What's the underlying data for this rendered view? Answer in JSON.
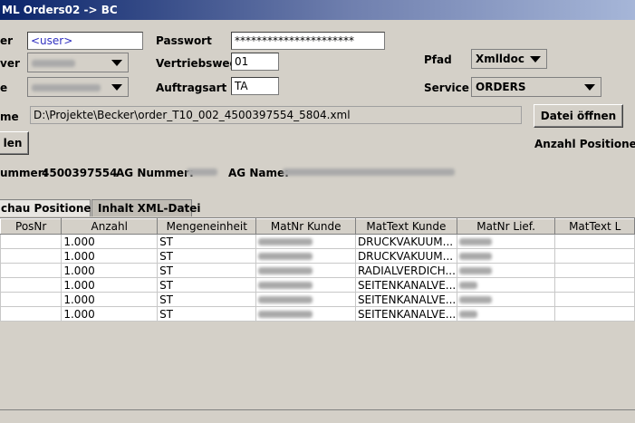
{
  "window": {
    "title": "ML Orders02 -> BC"
  },
  "form": {
    "user_label": "er",
    "user_value": "<user>",
    "server_label": "ver",
    "mandant_label": "e",
    "passwort_label": "Passwort",
    "passwort_value": "**********************",
    "vertriebsweg_label": "Vertriebsweg",
    "vertriebsweg_value": "01",
    "auftragsart_label": "Auftragsart",
    "auftragsart_value": "TA",
    "pfad_label": "Pfad",
    "pfad_value": "Xmlldoc",
    "service_label": "Service",
    "service_value": "ORDERS",
    "filename_label": "me",
    "filename_value": "D:\\Projekte\\Becker\\order_T10_002_4500397554_5804.xml",
    "datei_button": "Datei öffnen",
    "left_button": "len",
    "anzahl_label": "Anzahl Positionen:",
    "nummer_label": "ummer:",
    "nummer_value": "4500397554",
    "ag_nummer_label": "AG Nummer:",
    "ag_name_label": "AG Name:"
  },
  "tabs": [
    {
      "label": "chau Positionen",
      "active": true
    },
    {
      "label": "Inhalt XML-Datei",
      "active": false
    }
  ],
  "table": {
    "columns": [
      "PosNr",
      "Anzahl",
      "Mengeneinheit",
      "MatNr Kunde",
      "MatText Kunde",
      "MatNr Lief.",
      "MatText L"
    ],
    "rows": [
      {
        "anzahl": "1.000",
        "einheit": "ST",
        "mattext": "DRUCKVAKUUM..."
      },
      {
        "anzahl": "1.000",
        "einheit": "ST",
        "mattext": "DRUCKVAKUUM..."
      },
      {
        "anzahl": "1.000",
        "einheit": "ST",
        "mattext": "RADIALVERDICH..."
      },
      {
        "anzahl": "1.000",
        "einheit": "ST",
        "mattext": "SEITENKANALVE..."
      },
      {
        "anzahl": "1.000",
        "einheit": "ST",
        "mattext": "SEITENKANALVE..."
      },
      {
        "anzahl": "1.000",
        "einheit": "ST",
        "mattext": "SEITENKANALVE..."
      }
    ]
  }
}
